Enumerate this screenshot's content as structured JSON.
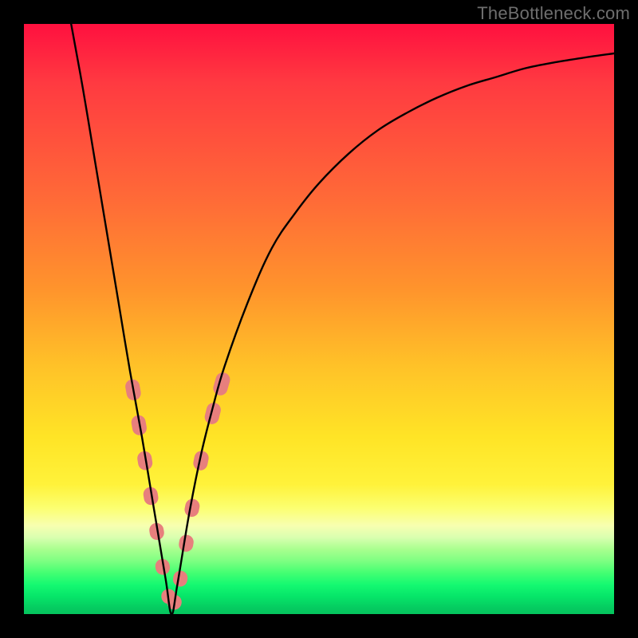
{
  "watermark": "TheBottleneck.com",
  "colors": {
    "frame": "#000000",
    "curve": "#000000",
    "marker": "#e77f7d",
    "marker_stroke": "#d86b69"
  },
  "chart_data": {
    "type": "line",
    "title": "",
    "xlabel": "",
    "ylabel": "",
    "xlim": [
      0,
      100
    ],
    "ylim": [
      0,
      100
    ],
    "series": [
      {
        "name": "bottleneck-curve",
        "description": "V-shaped bottleneck curve; y≈0 at optimum near x≈25, rising steeply on both sides",
        "x": [
          8,
          10,
          12,
          14,
          16,
          18,
          20,
          22,
          24,
          25,
          26,
          28,
          30,
          32,
          34,
          38,
          42,
          46,
          50,
          55,
          60,
          65,
          70,
          75,
          80,
          85,
          90,
          95,
          100
        ],
        "y": [
          100,
          89,
          77,
          65,
          53,
          41,
          30,
          18,
          6,
          0,
          5,
          17,
          27,
          35,
          42,
          53,
          62,
          68,
          73,
          78,
          82,
          85,
          87.5,
          89.5,
          91,
          92.5,
          93.5,
          94.3,
          95
        ]
      }
    ],
    "markers": {
      "name": "highlighted-points",
      "description": "Pink capsule markers along the lower section of both branches",
      "points": [
        {
          "x": 18.5,
          "y": 38
        },
        {
          "x": 19.5,
          "y": 32
        },
        {
          "x": 20.5,
          "y": 26
        },
        {
          "x": 21.5,
          "y": 20
        },
        {
          "x": 22.5,
          "y": 14
        },
        {
          "x": 23.5,
          "y": 8
        },
        {
          "x": 24.5,
          "y": 3
        },
        {
          "x": 25.5,
          "y": 2
        },
        {
          "x": 26.5,
          "y": 6
        },
        {
          "x": 27.5,
          "y": 12
        },
        {
          "x": 28.5,
          "y": 18
        },
        {
          "x": 30.0,
          "y": 26
        },
        {
          "x": 32.0,
          "y": 34
        },
        {
          "x": 33.5,
          "y": 39
        }
      ]
    }
  }
}
